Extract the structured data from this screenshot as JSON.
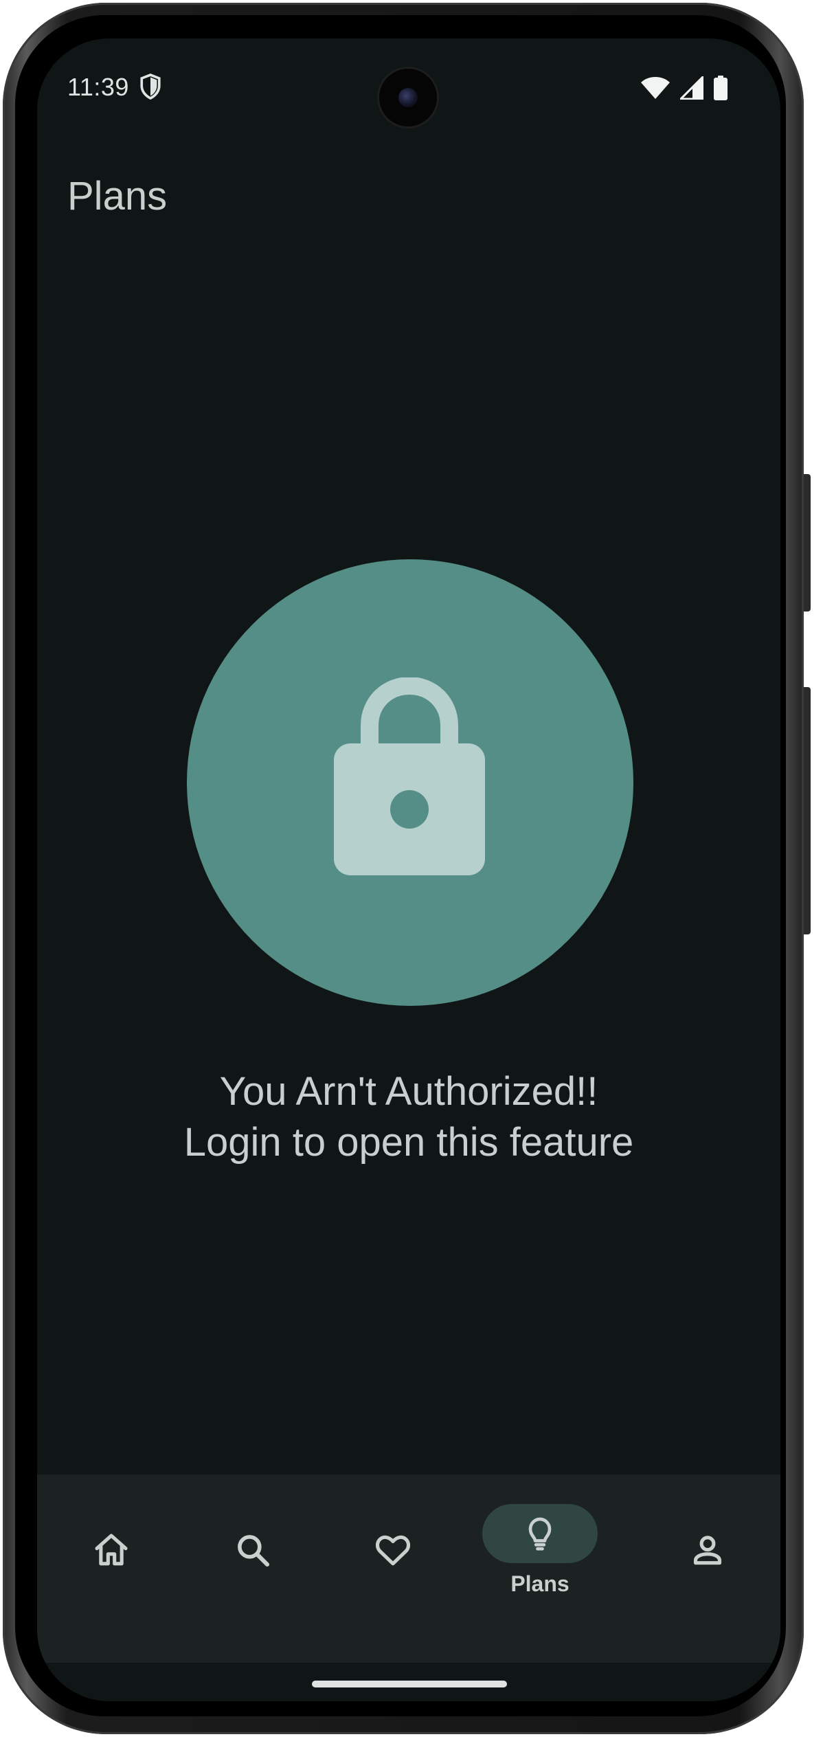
{
  "status_bar": {
    "time": "11:39",
    "icons": [
      "shield-icon",
      "wifi-icon",
      "signal-icon",
      "battery-icon"
    ]
  },
  "header": {
    "title": "Plans"
  },
  "main": {
    "icon": "lock-icon",
    "message_line1": "You Arn't Authorized!!",
    "message_line2": "Login to open this feature"
  },
  "bottom_nav": {
    "items": [
      {
        "icon": "home-icon",
        "label": "",
        "selected": false
      },
      {
        "icon": "search-icon",
        "label": "",
        "selected": false
      },
      {
        "icon": "heart-icon",
        "label": "",
        "selected": false
      },
      {
        "icon": "lightbulb-icon",
        "label": "Plans",
        "selected": true
      },
      {
        "icon": "person-icon",
        "label": "",
        "selected": false
      }
    ]
  },
  "colors": {
    "background": "#101616",
    "accent_circle": "#558d87",
    "lock_fill": "#b6d0cd",
    "nav_background": "#1b2221",
    "nav_selected_pill": "#2f4642",
    "text": "#c9cfce"
  }
}
